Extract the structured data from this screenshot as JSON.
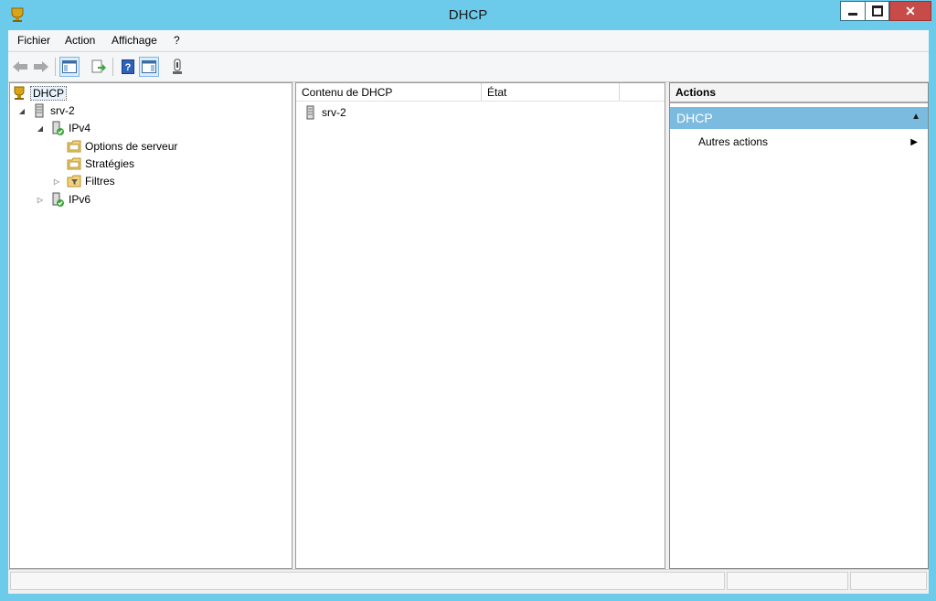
{
  "window": {
    "title": "DHCP"
  },
  "menubar": {
    "items": [
      "Fichier",
      "Action",
      "Affichage",
      "?"
    ]
  },
  "toolbar": {
    "buttons": [
      "back-arrow-icon",
      "forward-arrow-icon",
      "show-hide-tree-icon",
      "export-list-icon",
      "help-icon",
      "show-hide-action-pane-icon",
      "server-status-icon"
    ]
  },
  "tree": {
    "root": {
      "label": "DHCP",
      "icon": "dhcp-icon",
      "selected": true
    },
    "server": {
      "label": "srv-2",
      "icon": "server-icon",
      "expanded": true
    },
    "ipv4": {
      "label": "IPv4",
      "icon": "ipv4-icon",
      "expanded": true
    },
    "options": {
      "label": "Options de serveur",
      "icon": "folder-icon"
    },
    "policies": {
      "label": "Stratégies",
      "icon": "folder-icon"
    },
    "filters": {
      "label": "Filtres",
      "icon": "filter-folder-icon",
      "expanded": false
    },
    "ipv6": {
      "label": "IPv6",
      "icon": "ipv6-icon",
      "expanded": false
    }
  },
  "list": {
    "columns": [
      "Contenu de DHCP",
      "État"
    ],
    "rows": [
      {
        "name": "srv-2",
        "state": ""
      }
    ]
  },
  "actions": {
    "title": "Actions",
    "section": "DHCP",
    "items": [
      "Autres actions"
    ]
  },
  "colors": {
    "frame": "#6ccbea",
    "close": "#c74b49",
    "section": "#7bbbe0"
  }
}
